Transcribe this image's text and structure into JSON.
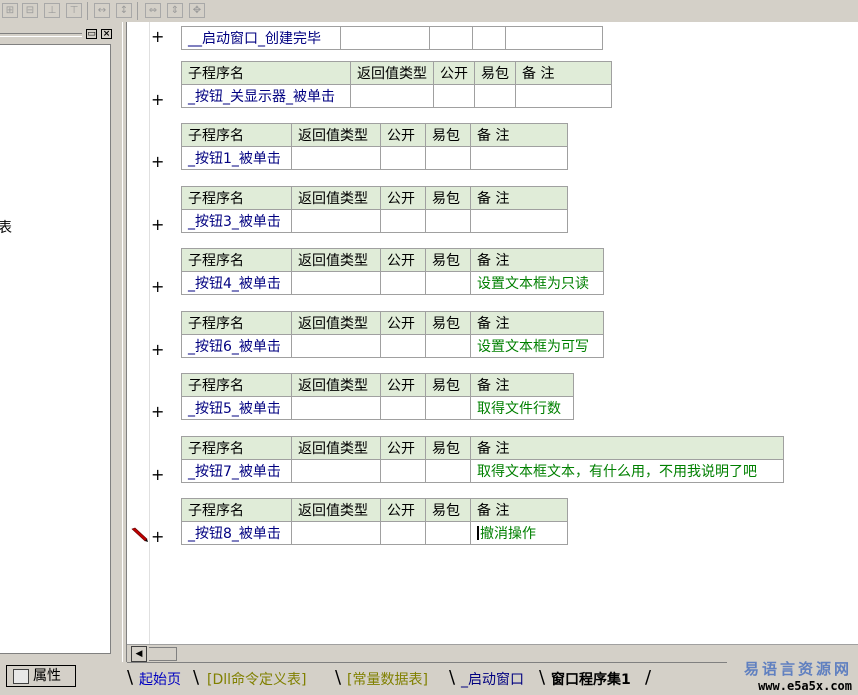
{
  "left_panel": {
    "cut_text": "表",
    "min_btn": "▭",
    "close_btn": "×"
  },
  "top_row": {
    "name": "__启动窗口_创建完毕"
  },
  "headers": {
    "name": "子程序名",
    "ret": "返回值类型",
    "pub": "公开",
    "pack": "易包",
    "note": "备 注"
  },
  "procedures": [
    {
      "name": "_按钮_关显示器_被单击",
      "note": ""
    },
    {
      "name": "_按钮1_被单击",
      "note": ""
    },
    {
      "name": "_按钮3_被单击",
      "note": ""
    },
    {
      "name": "_按钮4_被单击",
      "note": "设置文本框为只读"
    },
    {
      "name": "_按钮6_被单击",
      "note": "设置文本框为可写"
    },
    {
      "name": "_按钮5_被单击",
      "note": "取得文件行数"
    },
    {
      "name": "_按钮7_被单击",
      "note": "取得文本框文本，有什么用，不用我说明了吧"
    },
    {
      "name": "_按钮8_被单击",
      "note": "撤消操作"
    }
  ],
  "plus_symbol": "+",
  "properties_button": {
    "label": "属性"
  },
  "tabs": [
    "起始页",
    "[Dll命令定义表]",
    "[常量数据表]",
    "_启动窗口",
    "窗口程序集1"
  ],
  "scroll_left_arrow": "◀",
  "logo": {
    "cn": "易语言资源网",
    "url": "www.e5a5x.com"
  }
}
